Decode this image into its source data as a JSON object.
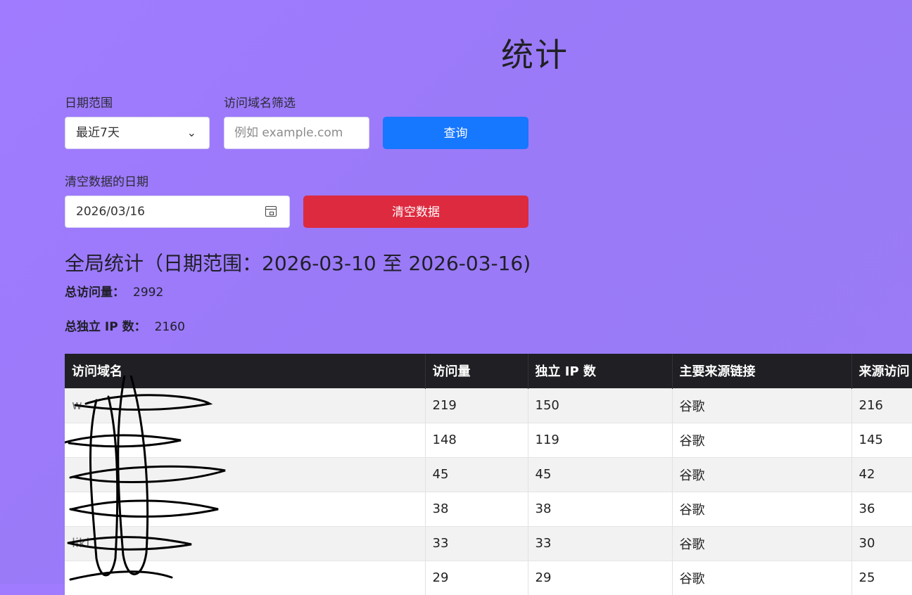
{
  "page": {
    "title": "统计"
  },
  "filters": {
    "date_range_label": "日期范围",
    "date_range_value": "最近7天",
    "domain_filter_label": "访问域名筛选",
    "domain_filter_placeholder": "例如 example.com",
    "query_button": "查询"
  },
  "clear": {
    "date_label": "清空数据的日期",
    "date_value": "2026/03/16",
    "button": "清空数据"
  },
  "summary": {
    "title": "全局统计（日期范围：2026-03-10 至 2026-03-16)",
    "total_visits_label": "总访问量：",
    "total_visits_value": "2992",
    "total_ips_label": "总独立 IP 数：",
    "total_ips_value": "2160"
  },
  "table": {
    "headers": [
      "访问域名",
      "访问量",
      "独立 IP 数",
      "主要来源链接",
      "来源访问"
    ],
    "rows": [
      {
        "domain": "w",
        "visits": "219",
        "unique_ips": "150",
        "source": "谷歌",
        "source_visits": "216"
      },
      {
        "domain": "",
        "visits": "148",
        "unique_ips": "119",
        "source": "谷歌",
        "source_visits": "145"
      },
      {
        "domain": "",
        "visits": "45",
        "unique_ips": "45",
        "source": "谷歌",
        "source_visits": "42"
      },
      {
        "domain": "",
        "visits": "38",
        "unique_ips": "38",
        "source": "谷歌",
        "source_visits": "36"
      },
      {
        "domain": "liki",
        "visits": "33",
        "unique_ips": "33",
        "source": "谷歌",
        "source_visits": "30"
      },
      {
        "domain": "",
        "visits": "29",
        "unique_ips": "29",
        "source": "谷歌",
        "source_visits": "25"
      }
    ]
  },
  "colors": {
    "background": "#9b7cf6",
    "primary": "#1677ff",
    "danger": "#dd2a3f",
    "table_header": "#1f1f24"
  },
  "icons": {
    "select": "chevron-down-icon",
    "date": "calendar-icon"
  }
}
